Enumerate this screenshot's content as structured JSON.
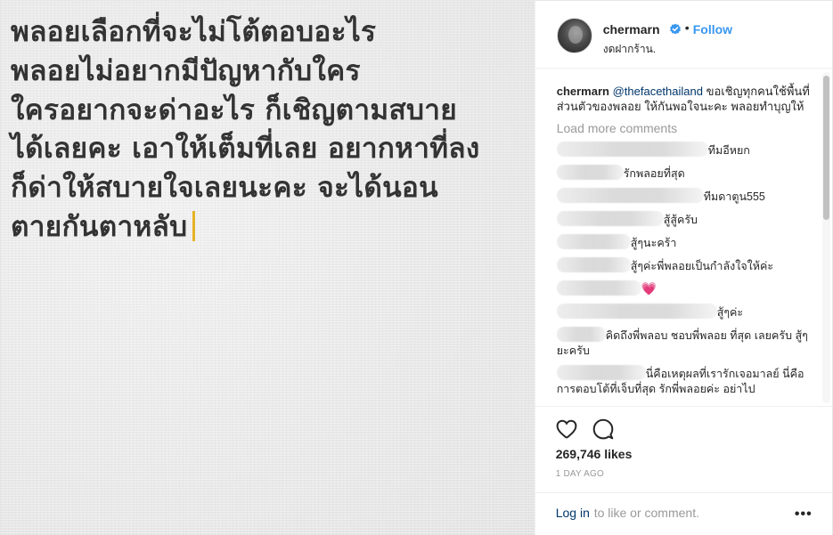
{
  "post": {
    "lines": [
      "พลอยเลือกที่จะไม่โต้ตอบอะไร",
      "พลอยไม่อยากมีปัญหากับใคร",
      "ใครอยากจะด่าอะไร ก็เชิญตามสบาย",
      "ได้เลยคะ เอาให้เต็มที่เลย อยากหาที่ลง",
      "ก็ด่าให้สบายใจเลยนะคะ จะได้นอน",
      "ตายกันตาหลับ"
    ],
    "cursor_color": "#e4b327"
  },
  "header": {
    "username": "chermarn",
    "verified_icon": "verified-badge-icon",
    "separator": "•",
    "follow_label": "Follow",
    "location": "งดฝากร้าน."
  },
  "caption": {
    "username": "chermarn",
    "mention": "@thefacethailand",
    "text": " ขอเชิญทุกคนใช้พื้นที่ส่วนตัวของพลอย ให้กันพอใจนะคะ พลอยทำบุญให้"
  },
  "load_more_label": "Load more comments",
  "comments": [
    {
      "text": "ทีมอีหยก",
      "blur_width": 170
    },
    {
      "text": "รักพลอยที่สุด",
      "blur_width": 75
    },
    {
      "text": "ทีมดาตูน555",
      "blur_width": 165
    },
    {
      "text": "สู้สู้ครับ",
      "blur_width": 120
    },
    {
      "text": "สู้ๆนะคร้า",
      "blur_width": 83
    },
    {
      "text": "สู้ๆค่ะพี่พลอยเป็นกำลังใจให้ค่ะ",
      "blur_width": 83
    },
    {
      "text": "💗",
      "blur_width": 95
    },
    {
      "text": "สู้ๆค่ะ",
      "blur_width": 180
    },
    {
      "text": "คิดถึงพี่พลอบ ชอบพี่พลอย ที่สุด เลยครับ สู้ๆยะครับ",
      "blur_width": 55
    },
    {
      "text": "นี่คือเหตุผลที่เรารักเจอมาลย์ นี่คือการตอบโต้ที่เจ็บที่สุด รักพี่พลอยค่ะ อย่าไป",
      "blur_width": 100
    }
  ],
  "actions": {
    "like_icon": "heart-outline-icon",
    "comment_icon": "speech-bubble-icon",
    "likes": "269,746 likes",
    "time": "1 DAY AGO",
    "login_link": "Log in",
    "login_rest": " to like or comment.",
    "more_icon": "more-options-icon",
    "more_glyph": "•••"
  },
  "colors": {
    "link_blue": "#3897f0",
    "dark_link": "#003569",
    "muted": "#999999",
    "text": "#262626"
  }
}
